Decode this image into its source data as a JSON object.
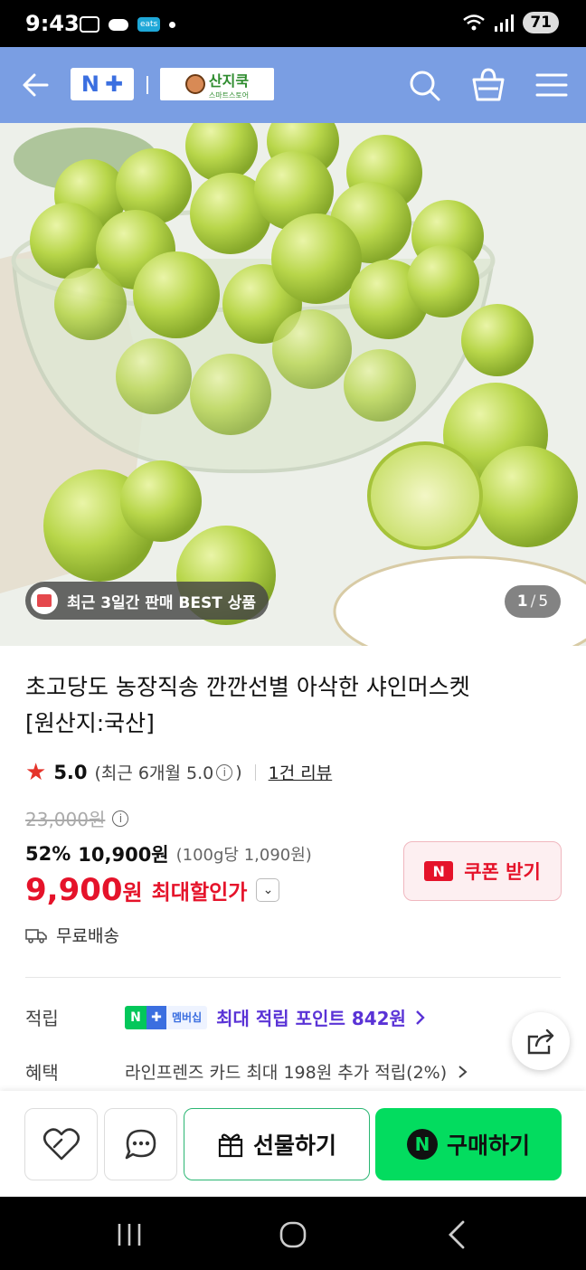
{
  "status_bar": {
    "time": "9:43",
    "eats": "eats",
    "battery": "71"
  },
  "header": {
    "store_name": "산지쿡",
    "store_sub": "스마트스토어"
  },
  "hero": {
    "best_badge": "최근 3일간 판매 BEST 상품",
    "page_current": "1",
    "page_total": "5"
  },
  "product": {
    "title_line1": "초고당도 농장직송 깐깐선별 아삭한 샤인머스켓",
    "title_line2": "[원산지:국산]",
    "rating": "5.0",
    "rating_recent": "(최근 6개월 5.0",
    "rating_recent_end": ")",
    "review_count": "1건 리뷰",
    "original_price": "23,000원",
    "discount_rate": "52%",
    "sale_price": "10,900원",
    "unit_price": "(100g당 1,090원)",
    "max_price_num": "9,900",
    "max_price_won": "원",
    "max_price_label": "최대할인가",
    "coupon_label": "쿠폰 받기",
    "shipping": "무료배송"
  },
  "benefits": {
    "points_label": "적립",
    "membership_tag": "멤버십",
    "points_text": "최대 적립 포인트 842원",
    "benefit_label": "혜택",
    "benefit_text": "라인프렌즈 카드 최대 198원 추가 적립(2%)"
  },
  "bottom": {
    "gift_label": "선물하기",
    "buy_label": "구매하기"
  },
  "colors": {
    "accent_red": "#e5132a",
    "naver_green": "#03c75a",
    "header_blue": "#7a9ee3",
    "points_purple": "#5a33d6"
  }
}
